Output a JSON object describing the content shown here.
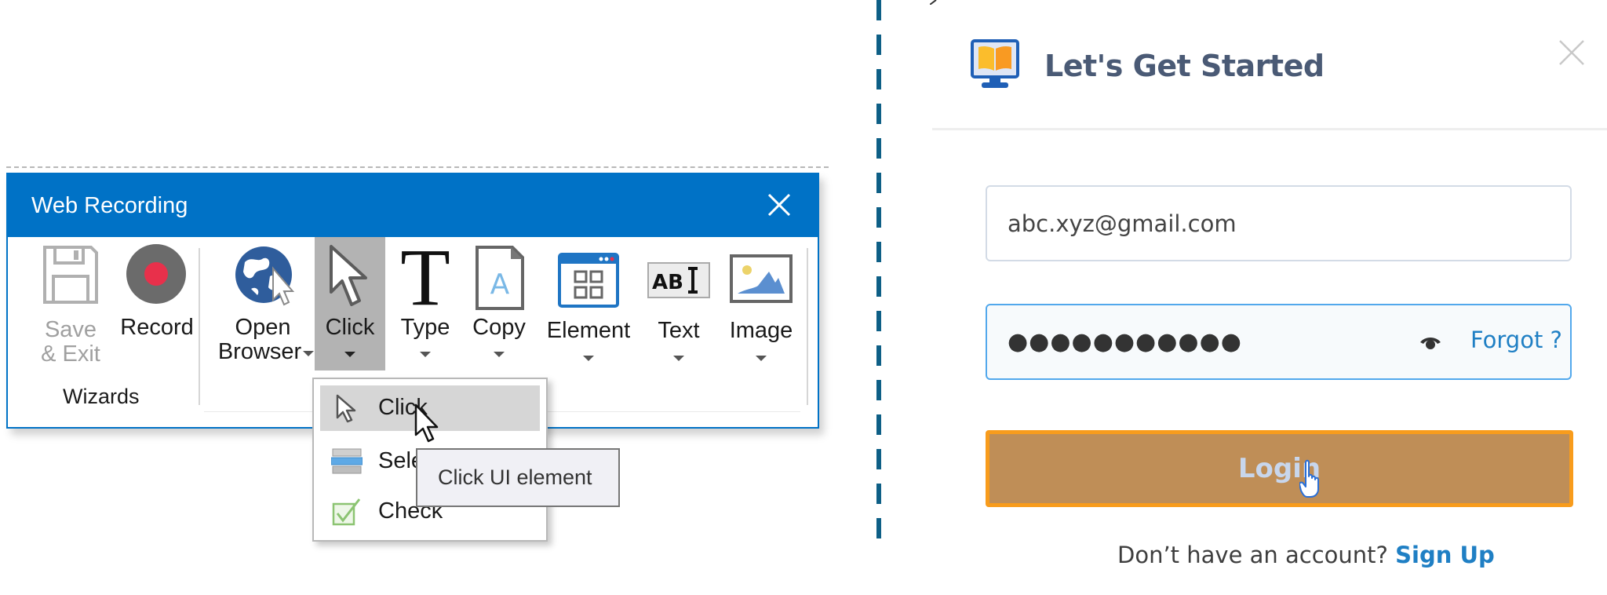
{
  "recorder": {
    "title": "Web Recording",
    "close_icon": "close-icon",
    "tools": [
      {
        "id": "save-exit",
        "line1": "Save",
        "line2": "& Exit",
        "icon": "floppy-disk-icon",
        "state": "disabled"
      },
      {
        "id": "record",
        "line1": "Record",
        "line2": "",
        "icon": "record-icon",
        "state": "normal"
      },
      {
        "id": "open-browser",
        "line1": "Open",
        "line2": "Browser",
        "icon": "globe-cursor-icon",
        "state": "normal",
        "dropdown": true
      },
      {
        "id": "click",
        "line1": "Click",
        "line2": "",
        "icon": "cursor-arrow-icon",
        "state": "active",
        "dropdown": true
      },
      {
        "id": "type",
        "line1": "Type",
        "line2": "",
        "icon": "letter-t-icon",
        "state": "normal",
        "dropdown": true
      },
      {
        "id": "copy",
        "line1": "Copy",
        "line2": "",
        "icon": "document-a-icon",
        "state": "normal",
        "dropdown": true
      },
      {
        "id": "element",
        "line1": "Element",
        "line2": "",
        "icon": "window-grid-icon",
        "state": "normal",
        "dropdown": true
      },
      {
        "id": "text",
        "line1": "Text",
        "line2": "",
        "icon": "text-cursor-icon",
        "state": "normal",
        "dropdown": true
      },
      {
        "id": "image",
        "line1": "Image",
        "line2": "",
        "icon": "picture-icon",
        "state": "normal",
        "dropdown": true
      }
    ],
    "group_label": "Wizards",
    "dropdown": {
      "items": [
        {
          "label": "Click",
          "icon": "cursor-arrow-icon",
          "highlighted": true
        },
        {
          "label": "Sele",
          "icon": "list-select-icon",
          "highlighted": false
        },
        {
          "label": "Check",
          "icon": "checkbox-check-icon",
          "highlighted": false
        }
      ]
    },
    "tooltip": "Click UI element",
    "colors": {
      "titlebar": "#0072c6",
      "active_tool": "#b3b3b3",
      "record_dot": "#e8304b"
    }
  },
  "login": {
    "title": "Let's Get Started",
    "email_value": "abc.xyz@gmail.com",
    "password_mask": "●●●●●●●●●●●",
    "forgot_label": "Forgot ?",
    "login_label": "Login",
    "signup_prompt": "Don’t have an account?",
    "signup_label": "Sign Up",
    "colors": {
      "login_bg": "#bf8e57",
      "login_border": "#f89c1c",
      "link": "#1f7fc4",
      "focus_border": "#52a8ec",
      "title": "#4a5a75"
    }
  }
}
